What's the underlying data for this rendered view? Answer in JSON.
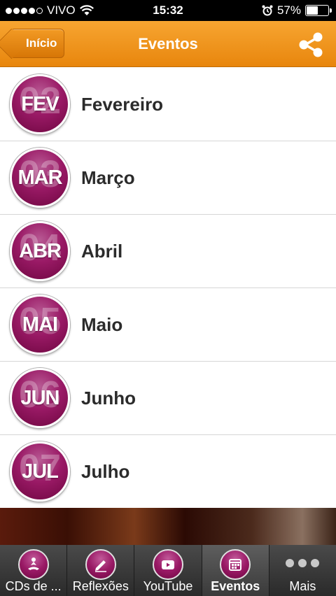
{
  "status_bar": {
    "carrier": "VIVO",
    "time": "15:32",
    "battery": "57%",
    "battery_level": 0.57,
    "signal_dots_filled": 4,
    "signal_dots_total": 5
  },
  "nav": {
    "back_label": "Início",
    "title": "Eventos"
  },
  "months": [
    {
      "abbr": "FEV",
      "num": "02",
      "label": "Fevereiro"
    },
    {
      "abbr": "MAR",
      "num": "03",
      "label": "Março"
    },
    {
      "abbr": "ABR",
      "num": "04",
      "label": "Abril"
    },
    {
      "abbr": "MAI",
      "num": "05",
      "label": "Maio"
    },
    {
      "abbr": "JUN",
      "num": "06",
      "label": "Junho"
    },
    {
      "abbr": "JUL",
      "num": "07",
      "label": "Julho"
    }
  ],
  "tabs": [
    {
      "label": "CDs de ...",
      "icon": "meditation-icon"
    },
    {
      "label": "Reflexões",
      "icon": "pencil-icon"
    },
    {
      "label": "YouTube",
      "icon": "youtube-icon"
    },
    {
      "label": "Eventos",
      "icon": "calendar-icon",
      "active": true
    },
    {
      "label": "Mais",
      "icon": "more-icon"
    }
  ],
  "colors": {
    "nav_orange": "#f29a24",
    "badge_purple": "#9a1a66",
    "tab_bar": "#3a3a3a"
  }
}
